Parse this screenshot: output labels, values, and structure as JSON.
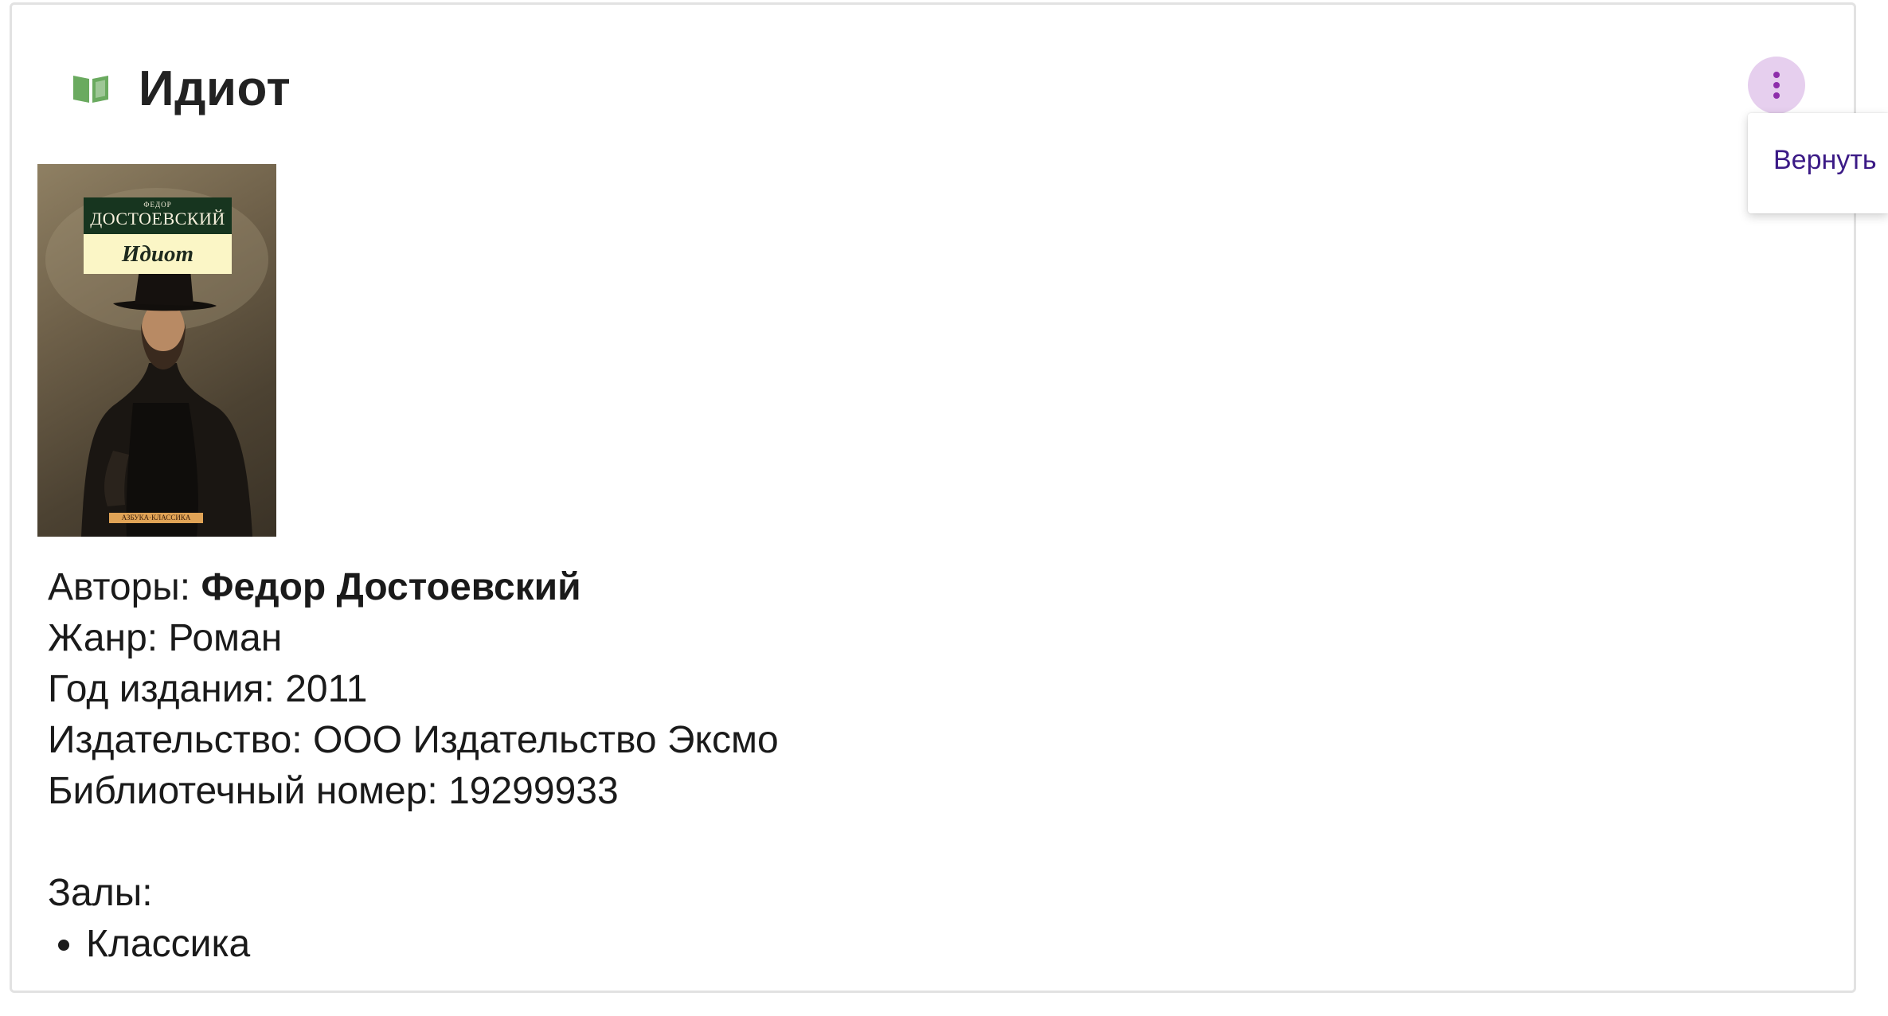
{
  "book": {
    "title": "Идиот",
    "cover": {
      "author_small": "ФЕДОР",
      "author_name": "ДОСТОЕВСКИЙ",
      "title": "Идиот",
      "publisher": "АЗБУКА·КЛАССИКА"
    },
    "authors_label": "Авторы: ",
    "authors_value": "Федор Достоевский",
    "genre": "Жанр: Роман",
    "year": "Год издания: 2011",
    "publisher": "Издательство: ООО Издательство Эксмо",
    "library_number": "Библиотечный номер: 19299933",
    "halls_label": "Залы:",
    "halls": [
      "Классика"
    ]
  },
  "menu": {
    "items": [
      {
        "label": "Вернуть"
      }
    ]
  },
  "icons": {
    "title_icon": "open-book-icon",
    "menu_icon": "more-vertical-icon"
  },
  "colors": {
    "book_icon": "#6aaa5f",
    "menu_button_bg": "#e6cfee",
    "menu_icon": "#8e2fab",
    "menu_item_text": "#3b1a86",
    "card_border": "#e2e2e2"
  }
}
